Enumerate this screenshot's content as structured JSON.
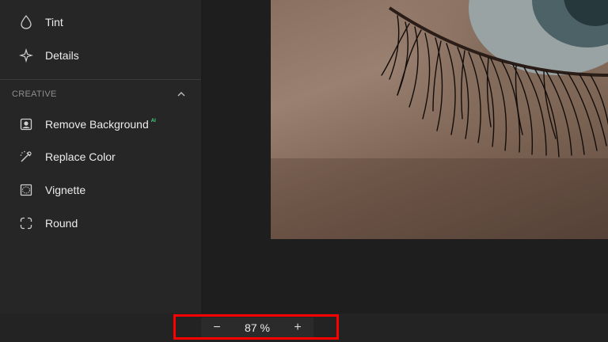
{
  "sidebar": {
    "top_items": [
      {
        "label": "Tint",
        "icon": "droplet-icon"
      },
      {
        "label": "Details",
        "icon": "sparkle-icon"
      }
    ],
    "section": {
      "title": "CREATIVE",
      "collapse_icon": "chevron-up-icon"
    },
    "creative_items": [
      {
        "label": "Remove Background",
        "badge": "AI",
        "icon": "remove-background-icon"
      },
      {
        "label": "Replace Color",
        "icon": "replace-color-icon"
      },
      {
        "label": "Vignette",
        "icon": "vignette-icon"
      },
      {
        "label": "Round",
        "icon": "round-corners-icon"
      }
    ]
  },
  "canvas": {
    "image": "close-up-eye-photo"
  },
  "zoom": {
    "minus": "−",
    "value": "87 %",
    "plus": "+"
  },
  "colors": {
    "sidebar_bg": "#262626",
    "canvas_bg": "#1e1e1e",
    "ai_badge": "#3ddc84",
    "highlight": "#ff0000"
  }
}
